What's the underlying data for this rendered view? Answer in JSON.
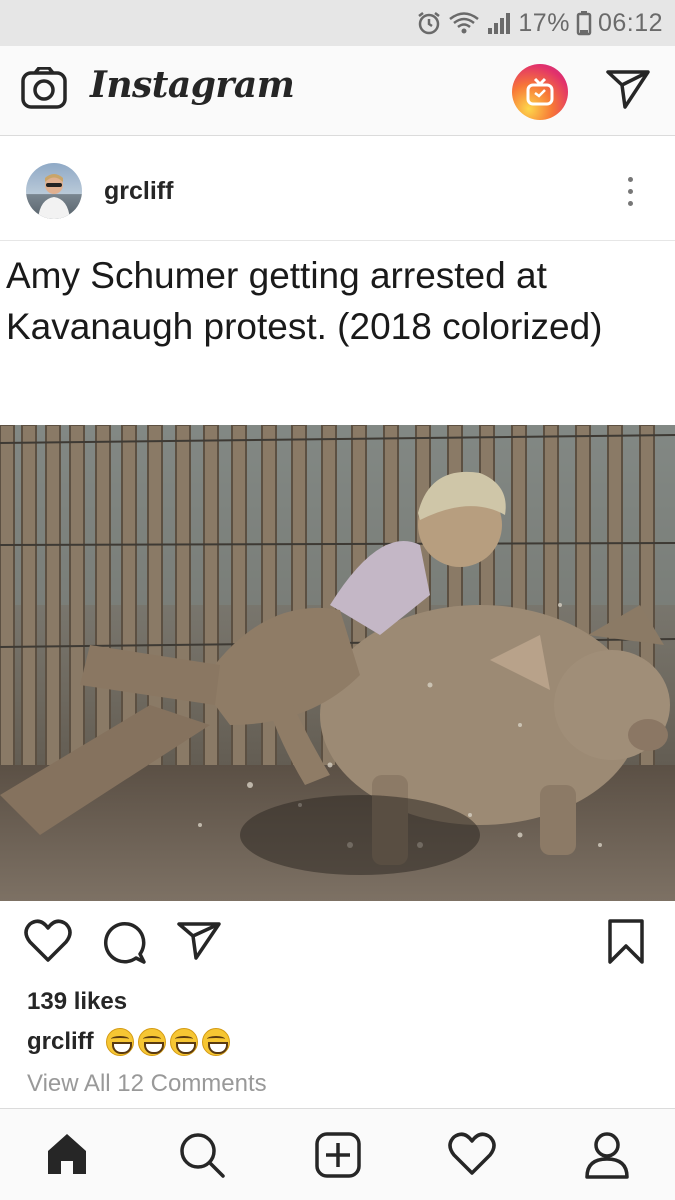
{
  "status_bar": {
    "battery": "17%",
    "time": "06:12",
    "icons": [
      "alarm-icon",
      "wifi-icon",
      "signal-icon",
      "battery-icon"
    ]
  },
  "header": {
    "brand": "Instagram",
    "icons": [
      "camera-icon",
      "igtv-icon",
      "direct-send-icon"
    ]
  },
  "post": {
    "username": "grcliff",
    "image_text": "Amy Schumer getting arrested at Kavanaugh protest. (2018 colorized)",
    "likes": "139 likes",
    "caption_user": "grcliff",
    "caption_emoji_count": 4,
    "view_comments": "View All 12 Comments"
  },
  "bottom_nav": [
    "home-icon",
    "search-icon",
    "new-post-icon",
    "activity-heart-icon",
    "profile-icon"
  ],
  "colors": {
    "igtv_gradient_start": "#fdd74b",
    "igtv_gradient_end": "#c13584",
    "muted_text": "#999999"
  }
}
